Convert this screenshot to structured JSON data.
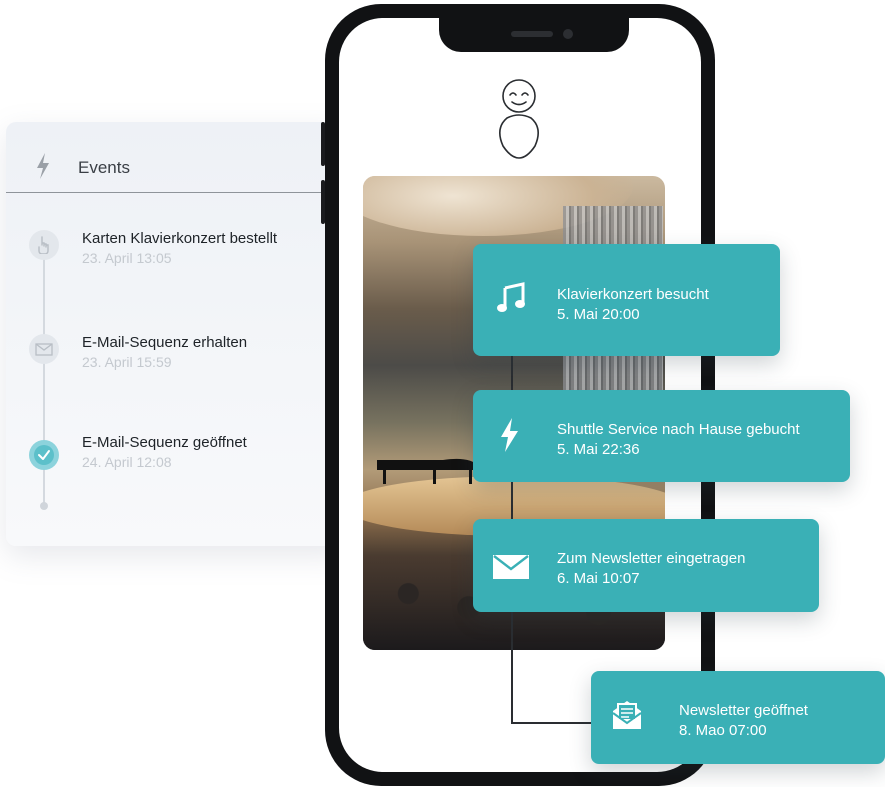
{
  "events_panel": {
    "title": "Events",
    "items": [
      {
        "title": "Karten Klavierkonzert bestellt",
        "time": "23. April 13:05",
        "icon": "hand-pointer-icon"
      },
      {
        "title": "E-Mail-Sequenz erhalten",
        "time": "23. April 15:59",
        "icon": "envelope-icon"
      },
      {
        "title": "E-Mail-Sequenz geöffnet",
        "time": "24. April 12:08",
        "icon": "check-circle-icon"
      }
    ]
  },
  "cards": [
    {
      "title": "Klavierkonzert besucht",
      "time": "5. Mai 20:00",
      "icon": "music-note-icon"
    },
    {
      "title": "Shuttle Service nach Hause gebucht",
      "time": "5. Mai 22:36",
      "icon": "lightning-icon"
    },
    {
      "title": "Zum Newsletter eingetragen",
      "time": "6. Mai 10:07",
      "icon": "envelope-icon"
    },
    {
      "title": "Newsletter geöffnet",
      "time": "8. Mao 07:00",
      "icon": "open-envelope-icon"
    }
  ],
  "colors": {
    "accent": "#3ab0b6",
    "panel": "#eef1f6",
    "phone": "#111214"
  }
}
